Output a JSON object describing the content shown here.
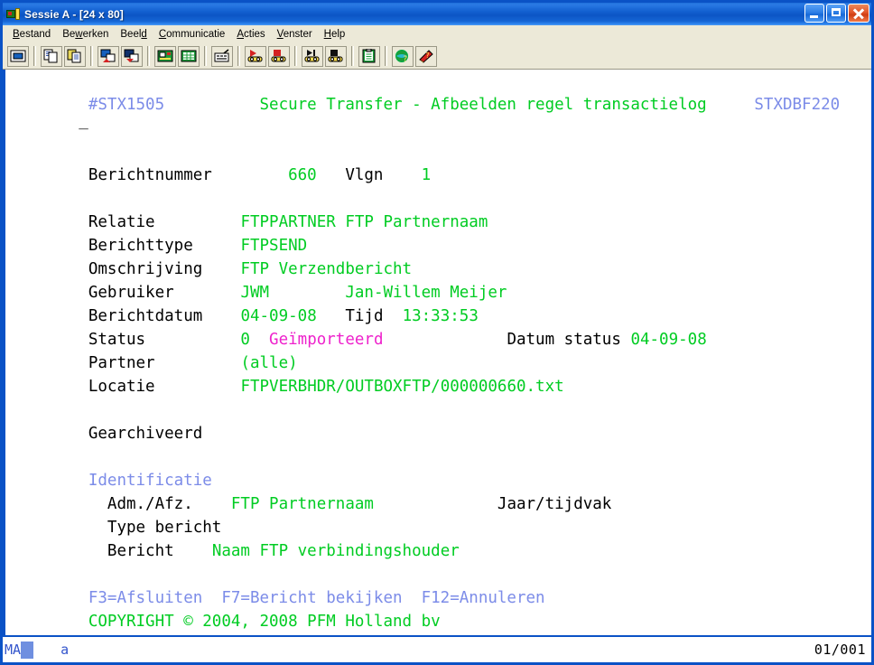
{
  "window": {
    "title": "Sessie A - [24 x 80]",
    "icon": "terminal-session-icon",
    "minimize_label": "",
    "maximize_label": "",
    "close_label": ""
  },
  "menu": {
    "items": [
      {
        "id": "bestand",
        "label": "Bestand",
        "accel_index": 0
      },
      {
        "id": "bewerken",
        "label": "Bewerken",
        "accel_index": 2
      },
      {
        "id": "beeld",
        "label": "Beeld",
        "accel_index": 4
      },
      {
        "id": "communicatie",
        "label": "Communicatie",
        "accel_index": 0
      },
      {
        "id": "acties",
        "label": "Acties",
        "accel_index": 0
      },
      {
        "id": "venster",
        "label": "Venster",
        "accel_index": 0
      },
      {
        "id": "help",
        "label": "Help",
        "accel_index": 0
      }
    ]
  },
  "toolbar": {
    "buttons": [
      "display-screen-icon",
      "copy-icon",
      "paste-icon",
      "send-file-icon",
      "receive-file-icon",
      "edit-keypad-icon",
      "spreadsheet-icon",
      "keyboard-remap-icon",
      "record-macro-icon",
      "stop-record-icon",
      "play-macro-icon",
      "stop-macro-icon",
      "clipboard-icon",
      "globe-help-icon",
      "index-help-icon"
    ]
  },
  "terminal": {
    "cols": 80,
    "rows": 24,
    "colors": {
      "black": "#000000",
      "green": "#00CC22",
      "blue": "#7C8CE8",
      "magenta": "#EE22CC",
      "background": "#FFFFFF",
      "border": "#0A52C6"
    },
    "screen_id": "#STX1505",
    "screen_title": "Secure Transfer - Afbeelden regel transactielog",
    "program_id": "STXDBF220",
    "fields": {
      "berichtnummer_label": "Berichtnummer",
      "berichtnummer_value": "660",
      "vlgn_label": "Vlgn",
      "vlgn_value": "1",
      "relatie_label": "Relatie",
      "relatie_code": "FTPPARTNER",
      "relatie_naam": "FTP Partnernaam",
      "berichttype_label": "Berichttype",
      "berichttype_value": "FTPSEND",
      "omschrijving_label": "Omschrijving",
      "omschrijving_value": "FTP Verzendbericht",
      "gebruiker_label": "Gebruiker",
      "gebruiker_code": "JWM",
      "gebruiker_naam": "Jan-Willem Meijer",
      "berichtdatum_label": "Berichtdatum",
      "berichtdatum_value": "04-09-08",
      "tijd_label": "Tijd",
      "tijd_value": "13:33:53",
      "status_label": "Status",
      "status_code": "0",
      "status_text": "Geïmporteerd",
      "datum_status_label": "Datum status",
      "datum_status_value": "04-09-08",
      "partner_label": "Partner",
      "partner_value": "(alle)",
      "locatie_label": "Locatie",
      "locatie_value": "FTPVERBHDR/OUTBOXFTP/000000660.txt",
      "gearchiveerd_label": "Gearchiveerd",
      "gearchiveerd_value": "",
      "identificatie_header": "Identificatie",
      "adm_afz_label": "Adm./Afz.",
      "adm_afz_value": "FTP Partnernaam",
      "jaar_tijdvak_label": "Jaar/tijdvak",
      "jaar_tijdvak_value": "",
      "type_bericht_label": "Type bericht",
      "type_bericht_value": "",
      "bericht_label": "Bericht",
      "bericht_value": "Naam FTP verbindingshouder"
    },
    "function_keys": "F3=Afsluiten  F7=Bericht bekijken  F12=Annuleren",
    "copyright": "COPYRIGHT © 2004, 2008 PFM Holland bv"
  },
  "status_bar": {
    "session_indicator": "MA",
    "input_field": "a",
    "cursor_position": "01/001"
  }
}
